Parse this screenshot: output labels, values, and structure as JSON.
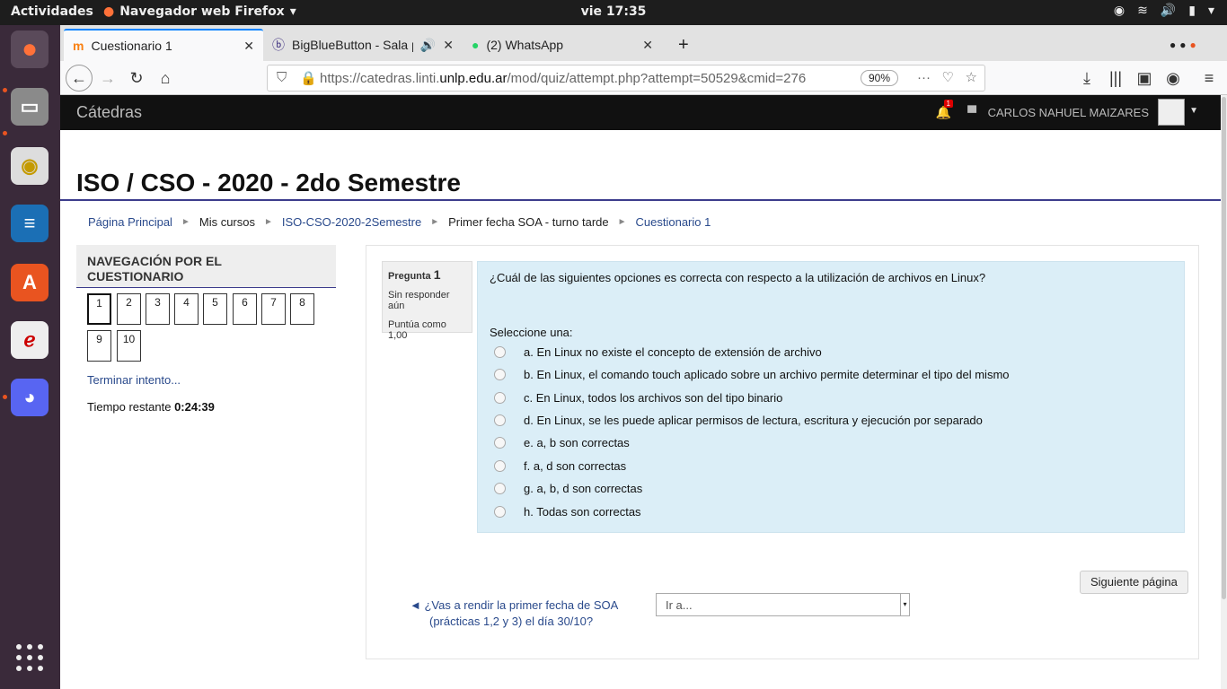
{
  "system": {
    "activities": "Actividades",
    "app_name": "Navegador web Firefox",
    "clock": "vie 17:35"
  },
  "tabs": [
    {
      "label": "Cuestionario 1"
    },
    {
      "label": "BigBlueButton - Sala p"
    },
    {
      "label": "(2) WhatsApp"
    }
  ],
  "url": {
    "prefix": "https://catedras.linti.",
    "domain": "unlp.edu.ar",
    "path": "/mod/quiz/attempt.php?attempt=50529&cmid=276",
    "zoom": "90%"
  },
  "moodle": {
    "brand": "Cátedras",
    "user": "CARLOS NAHUEL MAIZARES",
    "notif_count": "1"
  },
  "course_title": "ISO / CSO - 2020 - 2do Semestre",
  "breadcrumb": [
    "Página Principal",
    "Mis cursos",
    "ISO-CSO-2020-2Semestre",
    "Primer fecha SOA - turno tarde",
    "Cuestionario 1"
  ],
  "quiz_nav": {
    "heading_1": "NAVEGACIÓN POR EL",
    "heading_2": "CUESTIONARIO",
    "buttons": [
      "1",
      "2",
      "3",
      "4",
      "5",
      "6",
      "7",
      "8",
      "9",
      "10"
    ],
    "finish": "Terminar intento...",
    "timer_label": "Tiempo restante",
    "timer_value": "0:24:39"
  },
  "question": {
    "label": "Pregunta",
    "number": "1",
    "status": "Sin responder aún",
    "grade": "Puntúa como 1,00",
    "text": "¿Cuál de las siguientes opciones es correcta con respecto a la utilización de archivos en Linux?",
    "select_label": "Seleccione una:",
    "options": [
      "a. En Linux no existe el concepto de extensión de archivo",
      "b. En Linux, el comando touch aplicado sobre un archivo permite determinar el tipo del mismo",
      "c. En Linux, todos los archivos son del tipo binario",
      "d. En Linux, se les puede aplicar permisos de lectura, escritura y ejecución por separado",
      "e. a, b son correctas",
      "f. a, d son correctas",
      "g. a, b, d son correctas",
      "h. Todas son correctas"
    ]
  },
  "footer": {
    "next": "Siguiente página",
    "prev_line1": "◄ ¿Vas a rendir la primer fecha de SOA",
    "prev_line2": "(prácticas 1,2 y 3) el día 30/10?",
    "goto": "Ir a..."
  }
}
